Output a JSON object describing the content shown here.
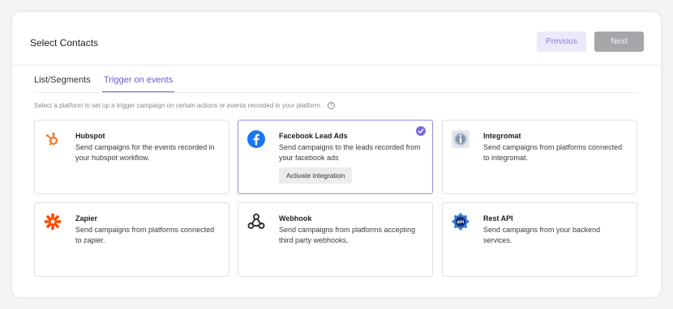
{
  "header": {
    "title": "Select Contacts",
    "previous_label": "Previous",
    "next_label": "Next"
  },
  "tabs": [
    {
      "label": "List/Segments",
      "active": false
    },
    {
      "label": "Trigger on events",
      "active": true
    }
  ],
  "hint": "Select a platform to set up a trigger campaign on certain actions or events recorded in your platform.",
  "cards": [
    {
      "name": "Hubspot",
      "description": "Send campaigns for the events recorded in your hubspot workflow.",
      "icon": "hubspot-icon",
      "selected": false
    },
    {
      "name": "Facebook Lead Ads",
      "description": "Send campaigns to the leads recorded from your facebook ads",
      "icon": "facebook-icon",
      "selected": true,
      "action_label": "Activate integration"
    },
    {
      "name": "Integromat",
      "description": "Send campaigns from platforms connected to integromat.",
      "icon": "integromat-icon",
      "selected": false
    },
    {
      "name": "Zapier",
      "description": "Send campaigns from platforms connected to zapier.",
      "icon": "zapier-icon",
      "selected": false
    },
    {
      "name": "Webhook",
      "description": "Send campaigns from platforms accepting third party webhooks.",
      "icon": "webhook-icon",
      "selected": false
    },
    {
      "name": "Rest API",
      "description": "Send campaigns from your backend services.",
      "icon": "rest-api-icon",
      "selected": false
    }
  ],
  "colors": {
    "accent": "#6f5bd8",
    "hubspot": "#f57722",
    "facebook": "#1877f2",
    "zapier": "#ff4a00"
  }
}
